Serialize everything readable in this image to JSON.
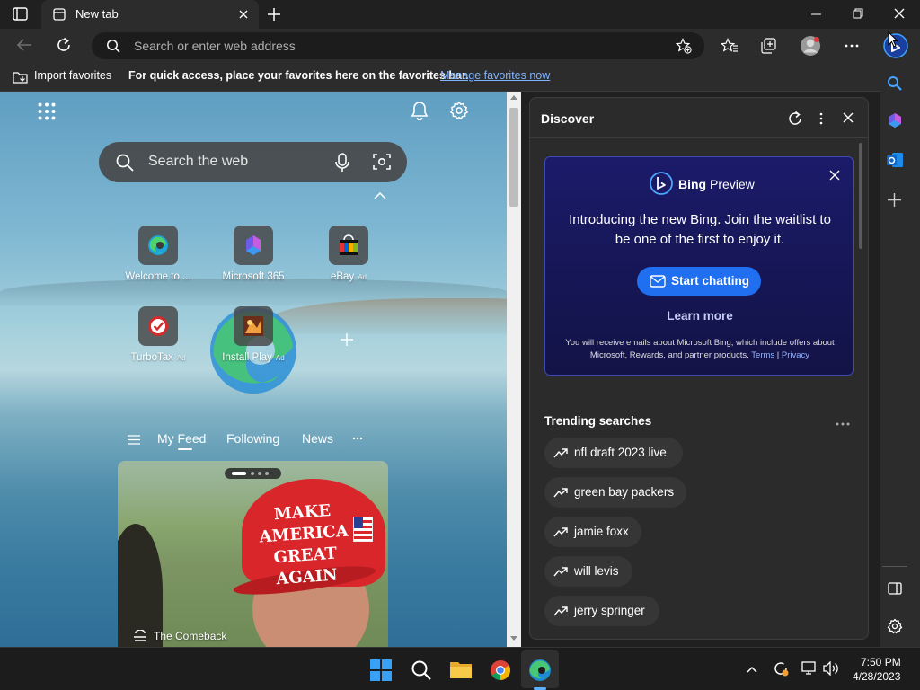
{
  "tab": {
    "title": "New tab"
  },
  "address_bar": {
    "placeholder": "Search or enter web address"
  },
  "favorites_bar": {
    "import_label": "Import favorites",
    "message": "For quick access, place your favorites here on the favorites bar.",
    "manage_link": "Manage favorites now"
  },
  "ntp": {
    "search_placeholder": "Search the web",
    "tiles": [
      {
        "label": "Welcome to ...",
        "ad": ""
      },
      {
        "label": "Microsoft 365",
        "ad": ""
      },
      {
        "label": "eBay",
        "ad": "Ad"
      },
      {
        "label": "TurboTax",
        "ad": "Ad"
      },
      {
        "label": "Install Play",
        "ad": "Ad"
      }
    ],
    "feed_tabs": [
      "My Feed",
      "Following",
      "News"
    ],
    "card_caption": "The Comeback",
    "cap_text_line1": "MAKE AMERICA",
    "cap_text_line2": "GREAT AGAIN"
  },
  "discover": {
    "title": "Discover",
    "bing": {
      "brand": "Bing",
      "badge": "Preview",
      "message": "Introducing the new Bing. Join the waitlist to be one of the first to enjoy it.",
      "start_button": "Start chatting",
      "learn_more": "Learn more",
      "fine_print": "You will receive emails about Microsoft Bing, which include offers about Microsoft, Rewards, and partner products.",
      "terms": "Terms",
      "privacy": "Privacy"
    },
    "trending_title": "Trending searches",
    "trending": [
      "nfl draft 2023 live",
      "green bay packers",
      "jamie foxx",
      "will levis",
      "jerry springer"
    ]
  },
  "taskbar": {
    "time": "7:50 PM",
    "date": "4/28/2023"
  },
  "colors": {
    "accent": "#1f6ff0",
    "bing_card_bg": "#161656",
    "panel_bg": "#2b2b2b"
  }
}
